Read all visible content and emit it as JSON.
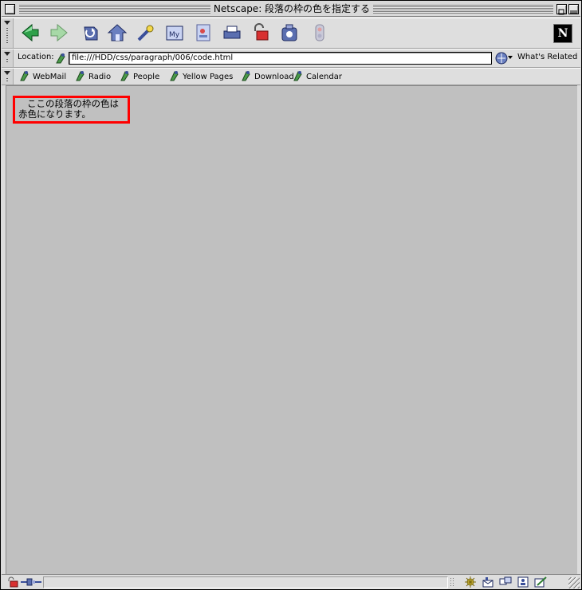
{
  "window": {
    "title": "Netscape: 段落の枠の色を指定する"
  },
  "nav_toolbar": {
    "buttons": [
      {
        "name": "back",
        "icon": "back-arrow-icon"
      },
      {
        "name": "forward",
        "icon": "forward-arrow-icon"
      },
      {
        "name": "reload",
        "icon": "reload-icon"
      },
      {
        "name": "home",
        "icon": "home-icon"
      },
      {
        "name": "search",
        "icon": "search-icon"
      },
      {
        "name": "my-netscape",
        "icon": "my-netscape-icon",
        "label": "My"
      },
      {
        "name": "images",
        "icon": "images-icon"
      },
      {
        "name": "print",
        "icon": "print-icon"
      },
      {
        "name": "security",
        "icon": "lock-icon"
      },
      {
        "name": "shop",
        "icon": "shop-icon"
      },
      {
        "name": "stop",
        "icon": "stop-icon"
      }
    ],
    "logo": "N"
  },
  "location": {
    "label": "Location:",
    "url": "file:///HDD/css/paragraph/006/code.html",
    "whats_related": "What's Related"
  },
  "bookmarks": [
    {
      "label": "WebMail"
    },
    {
      "label": "Radio"
    },
    {
      "label": "People"
    },
    {
      "label": "Yellow Pages"
    },
    {
      "label": "Download"
    },
    {
      "label": "Calendar"
    }
  ],
  "page": {
    "paragraph": "ここの段落の枠の色は赤色になります。",
    "background_color": "#c0c0c0",
    "border_color": "#ff0000"
  }
}
